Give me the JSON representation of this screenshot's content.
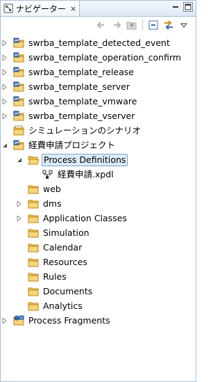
{
  "tab": {
    "title": "ナビゲーター",
    "close": "⨯"
  },
  "toolbar": {
    "back_icon": "back-arrow-icon",
    "forward_icon": "forward-arrow-icon",
    "up_icon": "up-folder-icon",
    "collapse_icon": "collapse-all-icon",
    "link_icon": "link-with-editor-icon"
  },
  "tree": [
    {
      "label": "swrba_template_detected_event",
      "icon": "project-icon",
      "depth": 0,
      "expander": "collapsed"
    },
    {
      "label": "swrba_template_operation_confirm",
      "icon": "project-icon",
      "depth": 0,
      "expander": "collapsed"
    },
    {
      "label": "swrba_template_release",
      "icon": "project-icon",
      "depth": 0,
      "expander": "collapsed"
    },
    {
      "label": "swrba_template_server",
      "icon": "project-icon",
      "depth": 0,
      "expander": "collapsed"
    },
    {
      "label": "swrba_template_vmware",
      "icon": "project-icon",
      "depth": 0,
      "expander": "collapsed"
    },
    {
      "label": "swrba_template_vserver",
      "icon": "project-icon",
      "depth": 0,
      "expander": "collapsed"
    },
    {
      "label": "シミュレーションのシナリオ",
      "icon": "closed-project-icon",
      "depth": 0,
      "expander": "none"
    },
    {
      "label": "経費申請プロジェクト",
      "icon": "project-icon",
      "depth": 0,
      "expander": "expanded"
    },
    {
      "label": "Process Definitions",
      "icon": "open-folder-icon",
      "depth": 1,
      "expander": "expanded",
      "selected": true
    },
    {
      "label": "経費申請.xpdl",
      "icon": "xpdl-file-icon",
      "depth": 2,
      "expander": "none"
    },
    {
      "label": "web",
      "icon": "folder-icon",
      "depth": 1,
      "expander": "none"
    },
    {
      "label": "dms",
      "icon": "folder-icon",
      "depth": 1,
      "expander": "collapsed"
    },
    {
      "label": "Application Classes",
      "icon": "folder-icon",
      "depth": 1,
      "expander": "collapsed"
    },
    {
      "label": "Simulation",
      "icon": "folder-icon",
      "depth": 1,
      "expander": "none"
    },
    {
      "label": "Calendar",
      "icon": "folder-icon",
      "depth": 1,
      "expander": "none"
    },
    {
      "label": "Resources",
      "icon": "folder-icon",
      "depth": 1,
      "expander": "none"
    },
    {
      "label": "Rules",
      "icon": "folder-icon",
      "depth": 1,
      "expander": "none"
    },
    {
      "label": "Documents",
      "icon": "folder-icon",
      "depth": 1,
      "expander": "none"
    },
    {
      "label": "Analytics",
      "icon": "folder-icon",
      "depth": 1,
      "expander": "none"
    },
    {
      "label": "Process Fragments",
      "icon": "fragments-project-icon",
      "depth": 0,
      "expander": "collapsed"
    }
  ],
  "colors": {
    "selection_bg": "#dceaf9",
    "selection_border": "#7da2ce",
    "folder": "#f2c14e",
    "project_blue": "#3d6fb6"
  }
}
